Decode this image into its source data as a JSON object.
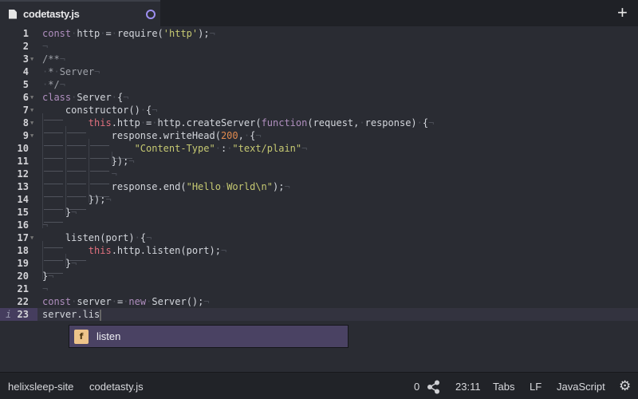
{
  "tab": {
    "title": "codetasty.js",
    "modified": true
  },
  "new_tab_label": "+",
  "lines": [
    {
      "n": 1,
      "fold": false,
      "indent": 0,
      "tokens": [
        [
          "const",
          "kw"
        ],
        [
          " http = require(",
          "id"
        ],
        [
          "'http'",
          "str"
        ],
        [
          ");",
          "id"
        ]
      ]
    },
    {
      "n": 2,
      "fold": false,
      "indent": 0,
      "tokens": []
    },
    {
      "n": 3,
      "fold": true,
      "indent": 0,
      "tokens": [
        [
          "/**",
          "cm"
        ]
      ]
    },
    {
      "n": 4,
      "fold": false,
      "indent": 0,
      "tokens": [
        [
          " * Server",
          "cm"
        ]
      ]
    },
    {
      "n": 5,
      "fold": false,
      "indent": 0,
      "tokens": [
        [
          " */",
          "cm"
        ]
      ]
    },
    {
      "n": 6,
      "fold": true,
      "indent": 0,
      "tokens": [
        [
          "class",
          "kw"
        ],
        [
          " Server {",
          "id"
        ]
      ]
    },
    {
      "n": 7,
      "fold": true,
      "indent": 1,
      "tokens": [
        [
          "constructor() {",
          "id"
        ]
      ]
    },
    {
      "n": 8,
      "fold": true,
      "indent": 2,
      "tokens": [
        [
          "this",
          "this"
        ],
        [
          ".http = http.createServer(",
          "id"
        ],
        [
          "function",
          "kw"
        ],
        [
          "(request, response) {",
          "id"
        ]
      ]
    },
    {
      "n": 9,
      "fold": true,
      "indent": 3,
      "tokens": [
        [
          "response.writeHead(",
          "id"
        ],
        [
          "200",
          "num"
        ],
        [
          ", {",
          "id"
        ]
      ]
    },
    {
      "n": 10,
      "fold": false,
      "indent": 4,
      "tokens": [
        [
          "\"Content-Type\"",
          "str"
        ],
        [
          " : ",
          "id"
        ],
        [
          "\"text/plain\"",
          "str"
        ]
      ]
    },
    {
      "n": 11,
      "fold": false,
      "indent": 3,
      "tokens": [
        [
          "});",
          "id"
        ]
      ]
    },
    {
      "n": 12,
      "fold": false,
      "indent": 3,
      "tokens": []
    },
    {
      "n": 13,
      "fold": false,
      "indent": 3,
      "tokens": [
        [
          "response.end(",
          "id"
        ],
        [
          "\"Hello World\\n\"",
          "str"
        ],
        [
          ");",
          "id"
        ]
      ]
    },
    {
      "n": 14,
      "fold": false,
      "indent": 2,
      "tokens": [
        [
          "});",
          "id"
        ]
      ]
    },
    {
      "n": 15,
      "fold": false,
      "indent": 1,
      "tokens": [
        [
          "}",
          "id"
        ]
      ]
    },
    {
      "n": 16,
      "fold": false,
      "indent": 0,
      "tokens": []
    },
    {
      "n": 17,
      "fold": true,
      "indent": 1,
      "tokens": [
        [
          "listen(port) {",
          "id"
        ]
      ]
    },
    {
      "n": 18,
      "fold": false,
      "indent": 2,
      "tokens": [
        [
          "this",
          "this"
        ],
        [
          ".http.listen(port);",
          "id"
        ]
      ]
    },
    {
      "n": 19,
      "fold": false,
      "indent": 1,
      "tokens": [
        [
          "}",
          "id"
        ]
      ]
    },
    {
      "n": 20,
      "fold": false,
      "indent": 0,
      "tokens": [
        [
          "}",
          "id"
        ]
      ]
    },
    {
      "n": 21,
      "fold": false,
      "indent": 0,
      "tokens": []
    },
    {
      "n": 22,
      "fold": false,
      "indent": 0,
      "tokens": [
        [
          "const",
          "kw"
        ],
        [
          " server = ",
          "id"
        ],
        [
          "new",
          "kw"
        ],
        [
          " Server();",
          "id"
        ]
      ]
    },
    {
      "n": 23,
      "fold": false,
      "indent": 0,
      "current": true,
      "info": "i",
      "tokens": [
        [
          "server.lis",
          "id"
        ]
      ]
    }
  ],
  "autocomplete": {
    "type_icon": "f",
    "suggestion": "listen"
  },
  "status": {
    "project": "helixsleep-site",
    "file": "codetasty.js",
    "git_count": "0",
    "cursor": "23:11",
    "indent": "Tabs",
    "line_ending": "LF",
    "grammar": "JavaScript"
  }
}
